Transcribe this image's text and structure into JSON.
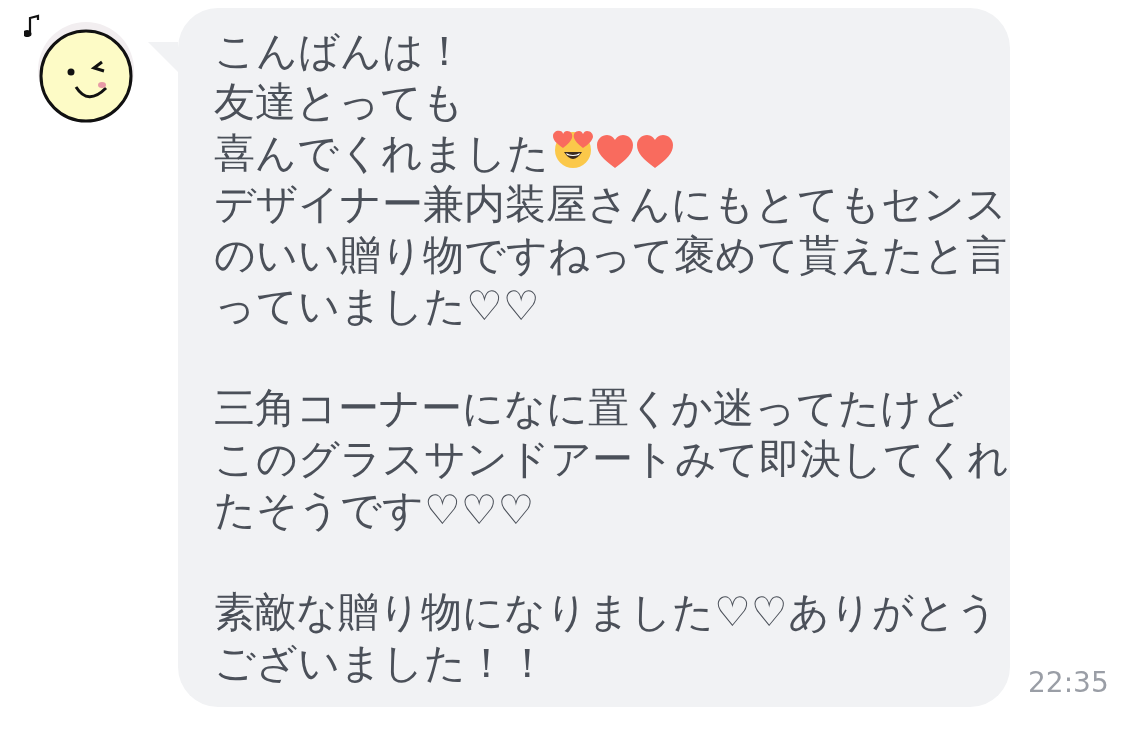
{
  "message": {
    "paragraphs": [
      {
        "lines": [
          {
            "text": "こんばんは！"
          },
          {
            "text": "友達とっても"
          },
          {
            "text": "喜んでくれました",
            "emoji": [
              {
                "kind": "heart_eyes"
              },
              {
                "kind": "heart"
              },
              {
                "kind": "heart"
              }
            ]
          },
          {
            "text": "デザイナー兼内装屋さんにもとてもセンス"
          },
          {
            "text": "のいい贈り物ですねって褒めて貰えたと言"
          },
          {
            "text": "っていました♡♡"
          }
        ]
      },
      {
        "lines": [
          {
            "text": "三角コーナーになに置くか迷ってたけど"
          },
          {
            "text": "このグラスサンドアートみて即決してくれ"
          },
          {
            "text": "たそうです♡♡♡"
          }
        ]
      },
      {
        "lines": [
          {
            "text": "素敵な贈り物になりました♡♡ありがとう"
          },
          {
            "text": "ございました！！"
          }
        ]
      }
    ],
    "time": "22:35"
  }
}
